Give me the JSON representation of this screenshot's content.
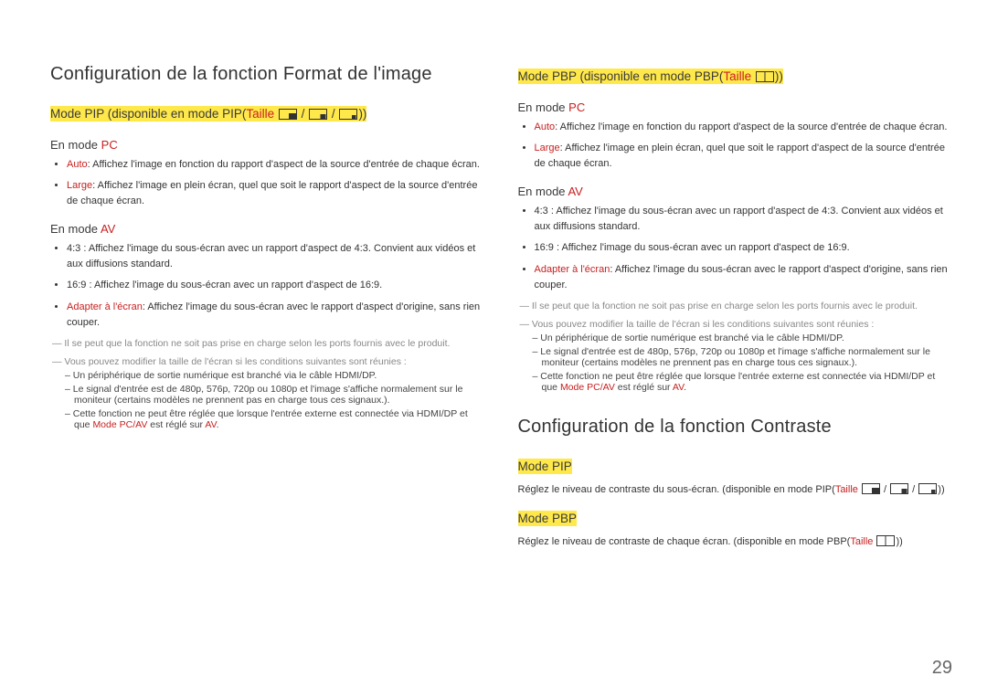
{
  "page_number": "29",
  "left": {
    "h1": "Configuration de la fonction Format de l'image",
    "subtitle_pre": "Mode PIP (disponible en mode PIP(",
    "subtitle_taille": "Taille",
    "subtitle_post": "))",
    "pc": {
      "head_pre": "En mode ",
      "head_mode": "PC",
      "b1_term": "Auto",
      "b1_rest": ": Affichez l'image en fonction du rapport d'aspect de la source d'entrée de chaque écran.",
      "b2_term": "Large",
      "b2_rest": ": Affichez l'image en plein écran, quel que soit le rapport d'aspect de la source d'entrée de chaque écran."
    },
    "av": {
      "head_pre": "En mode ",
      "head_mode": "AV",
      "b1": "4:3 : Affichez l'image du sous-écran avec un rapport d'aspect de 4:3. Convient aux vidéos et aux diffusions standard.",
      "b2": "16:9 : Affichez l'image du sous-écran avec un rapport d'aspect de 16:9.",
      "b3_term": "Adapter à l'écran",
      "b3_rest": ": Affichez l'image du sous-écran avec le rapport d'aspect d'origine, sans rien couper."
    },
    "n1": "― Il se peut que la fonction ne soit pas prise en charge selon les ports fournis avec le produit.",
    "n2": "― Vous pouvez modifier la taille de l'écran si les conditions suivantes sont réunies :",
    "n3": "– Un périphérique de sortie numérique est branché via le câble HDMI/DP.",
    "n4": "– Le signal d'entrée est de 480p, 576p, 720p ou 1080p et l'image s'affiche normalement sur le moniteur (certains modèles ne prennent pas en charge tous ces signaux.).",
    "n5_pre": "– Cette fonction ne peut être réglée que lorsque l'entrée externe est connectée via HDMI/DP et que ",
    "n5_red1": "Mode PC/AV",
    "n5_mid": " est réglé sur ",
    "n5_red2": "AV",
    "n5_end": "."
  },
  "right": {
    "pbp_subtitle_pre": "Mode PBP (disponible en mode PBP(",
    "pbp_subtitle_taille": "Taille",
    "pbp_subtitle_post": "))",
    "pc": {
      "head_pre": "En mode ",
      "head_mode": "PC",
      "b1_term": "Auto",
      "b1_rest": ": Affichez l'image en fonction du rapport d'aspect de la source d'entrée de chaque écran.",
      "b2_term": "Large",
      "b2_rest": ": Affichez l'image en plein écran, quel que soit le rapport d'aspect de la source d'entrée de chaque écran."
    },
    "av": {
      "head_pre": "En mode ",
      "head_mode": "AV",
      "b1": "4:3 : Affichez l'image du sous-écran avec un rapport d'aspect de 4:3. Convient aux vidéos et aux diffusions standard.",
      "b2": "16:9 : Affichez l'image du sous-écran avec un rapport d'aspect de 16:9.",
      "b3_term": "Adapter à l'écran",
      "b3_rest": ": Affichez l'image du sous-écran avec le rapport d'aspect d'origine, sans rien couper."
    },
    "n1": "― Il se peut que la fonction ne soit pas prise en charge selon les ports fournis avec le produit.",
    "n2": "― Vous pouvez modifier la taille de l'écran si les conditions suivantes sont réunies :",
    "n3": "– Un périphérique de sortie numérique est branché via le câble HDMI/DP.",
    "n4": "– Le signal d'entrée est de 480p, 576p, 720p ou 1080p et l'image s'affiche normalement sur le moniteur (certains modèles ne prennent pas en charge tous ces signaux.).",
    "n5_pre": "– Cette fonction ne peut être réglée que lorsque l'entrée externe est connectée via HDMI/DP et que ",
    "n5_red1": "Mode PC/AV",
    "n5_mid": " est réglé sur ",
    "n5_red2": "AV",
    "n5_end": ".",
    "h1b": "Configuration de la fonction Contraste",
    "mode_pip": "Mode PIP",
    "pip_text_pre": "Réglez le niveau de contraste du sous-écran. (disponible en mode PIP(",
    "pip_text_taille": "Taille",
    "pip_text_post": "))",
    "mode_pbp": "Mode PBP",
    "pbp_text_pre": "Réglez le niveau de contraste de chaque écran. (disponible en mode PBP(",
    "pbp_text_taille": "Taille",
    "pbp_text_post": "))"
  },
  "slash": " / "
}
